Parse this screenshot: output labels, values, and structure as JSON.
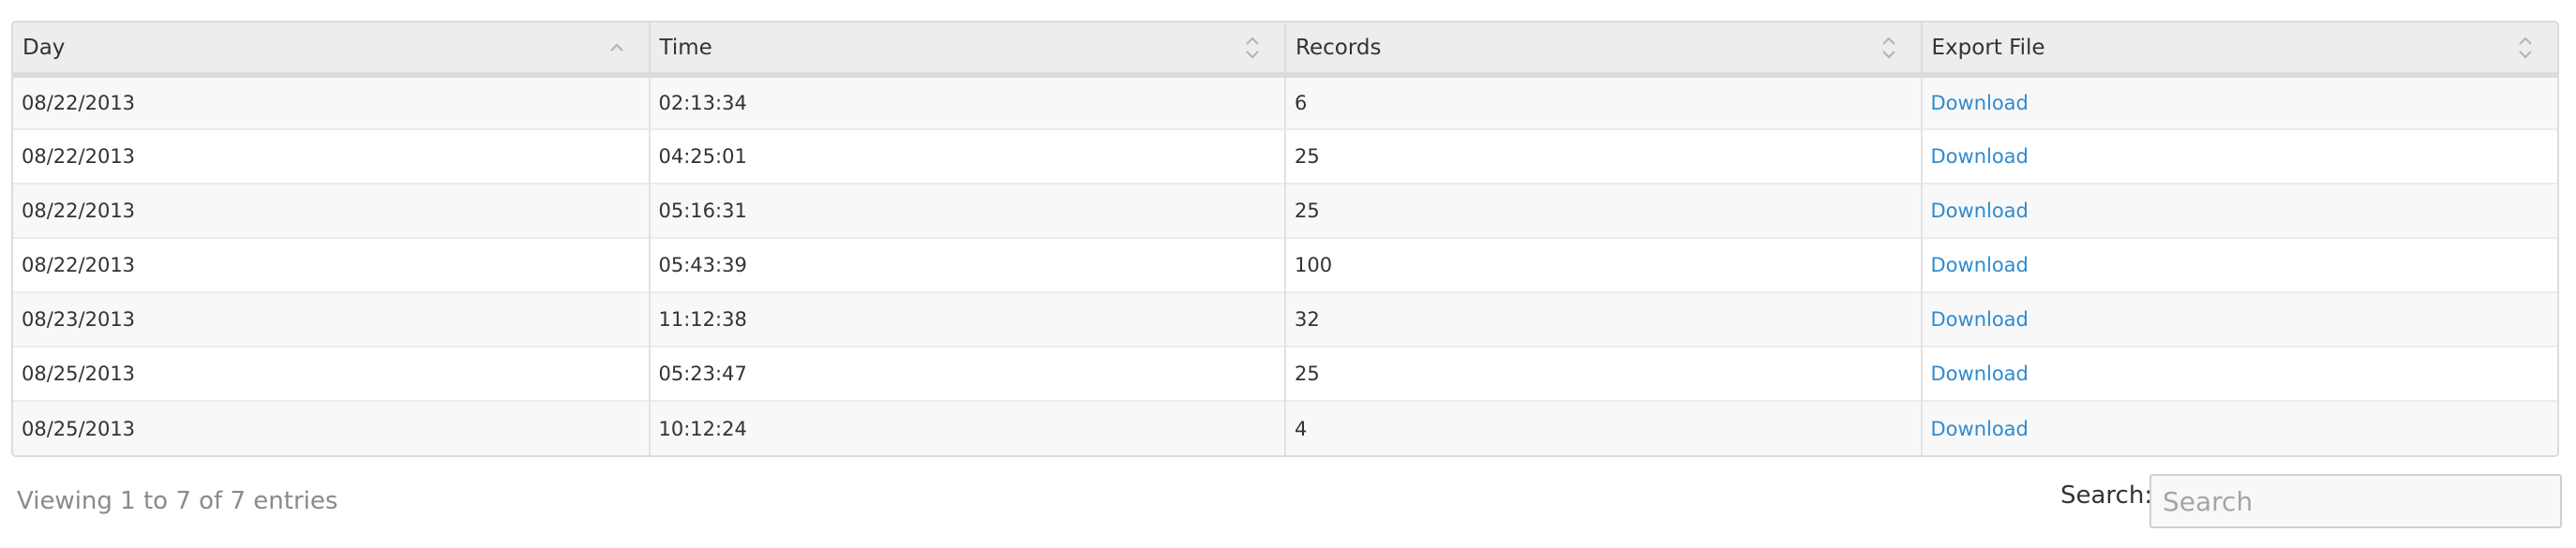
{
  "table": {
    "columns": [
      {
        "label": "Day",
        "sort": "ascending",
        "sort_icon": "sort-up-icon"
      },
      {
        "label": "Time",
        "sort": "none",
        "sort_icon": "sort-both-icon"
      },
      {
        "label": "Records",
        "sort": "none",
        "sort_icon": "sort-both-icon"
      },
      {
        "label": "Export File",
        "sort": "none",
        "sort_icon": "sort-both-icon"
      }
    ],
    "rows": [
      {
        "day": "08/22/2013",
        "time": "02:13:34",
        "records": "6",
        "export": "Download"
      },
      {
        "day": "08/22/2013",
        "time": "04:25:01",
        "records": "25",
        "export": "Download"
      },
      {
        "day": "08/22/2013",
        "time": "05:16:31",
        "records": "25",
        "export": "Download"
      },
      {
        "day": "08/22/2013",
        "time": "05:43:39",
        "records": "100",
        "export": "Download"
      },
      {
        "day": "08/23/2013",
        "time": "11:12:38",
        "records": "32",
        "export": "Download"
      },
      {
        "day": "08/25/2013",
        "time": "05:23:47",
        "records": "25",
        "export": "Download"
      },
      {
        "day": "08/25/2013",
        "time": "10:12:24",
        "records": "4",
        "export": "Download"
      }
    ]
  },
  "footer": {
    "info": "Viewing 1 to 7 of 7 entries",
    "search_label": "Search:",
    "search_placeholder": "Search",
    "search_value": ""
  },
  "colors": {
    "link": "#2e8bd0",
    "header_bg": "#ededed",
    "row_alt_bg": "#f8f8f8",
    "info_text": "#8a8a8a"
  }
}
